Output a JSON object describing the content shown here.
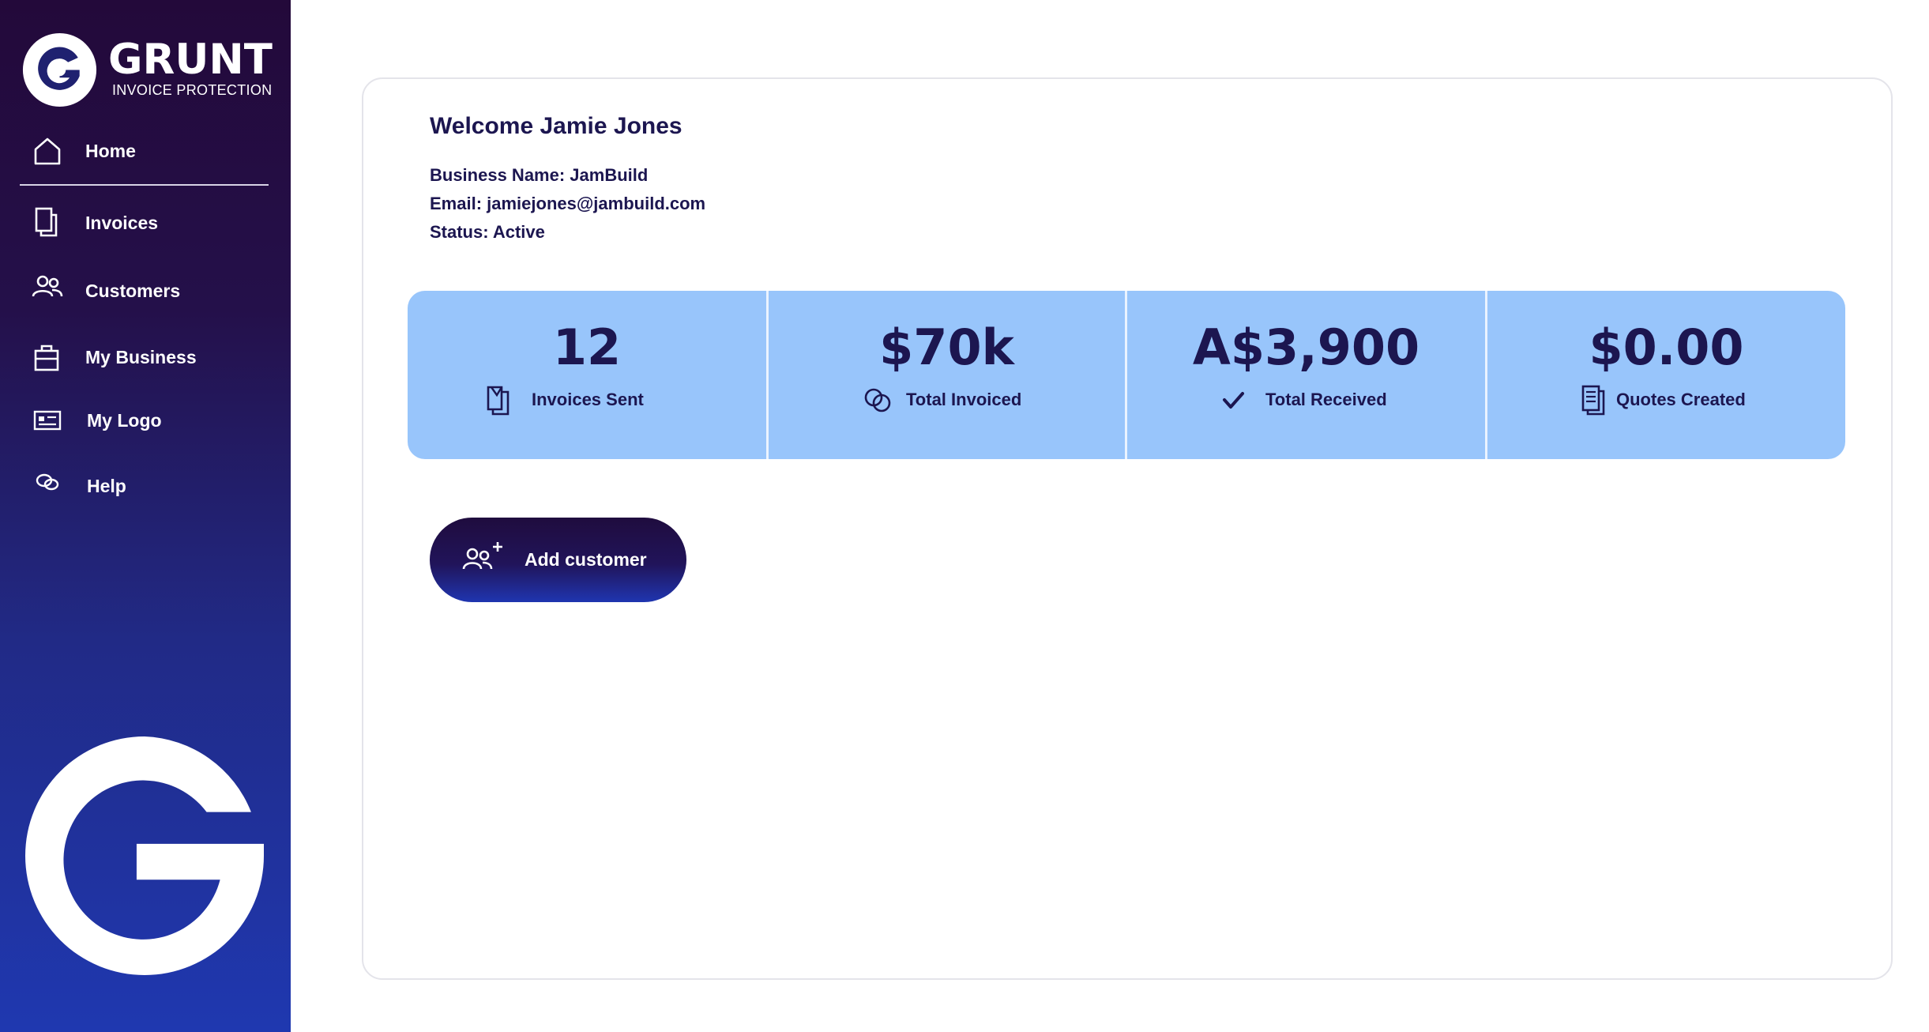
{
  "brand": {
    "name": "GRUNT",
    "tagline": "INVOICE PROTECTION",
    "logo_icon": "grunt-g-logo"
  },
  "sidebar": {
    "items": [
      {
        "label": "Home",
        "icon": "home-icon"
      },
      {
        "label": "Invoices",
        "icon": "invoice-icon"
      },
      {
        "label": "Customers",
        "icon": "users-icon"
      },
      {
        "label": "My Business",
        "icon": "briefcase-icon"
      },
      {
        "label": "My Logo",
        "icon": "id-card-icon"
      },
      {
        "label": "Help",
        "icon": "chat-bubbles-icon"
      }
    ]
  },
  "profile": {
    "welcome": "Welcome Jamie Jones",
    "business_line": "Business Name: JamBuild",
    "email_line": "Email: jamiejones@jambuild.com",
    "status_line": "Status: Active"
  },
  "stats": [
    {
      "value": "12",
      "label": "Invoices Sent",
      "icon": "invoice-sent-icon"
    },
    {
      "value": "$70k",
      "label": "Total Invoiced",
      "icon": "coins-icon"
    },
    {
      "value": "A$3,900",
      "label": "Total Received",
      "icon": "checkmark-icon"
    },
    {
      "value": "$0.00",
      "label": "Quotes Created",
      "icon": "quote-document-icon"
    }
  ],
  "actions": {
    "add_customer": "Add customer"
  },
  "colors": {
    "sidebar_top": "#23093a",
    "sidebar_bottom": "#1f38b0",
    "stats_bg": "#98c5fb",
    "text_dark": "#1c1650"
  }
}
